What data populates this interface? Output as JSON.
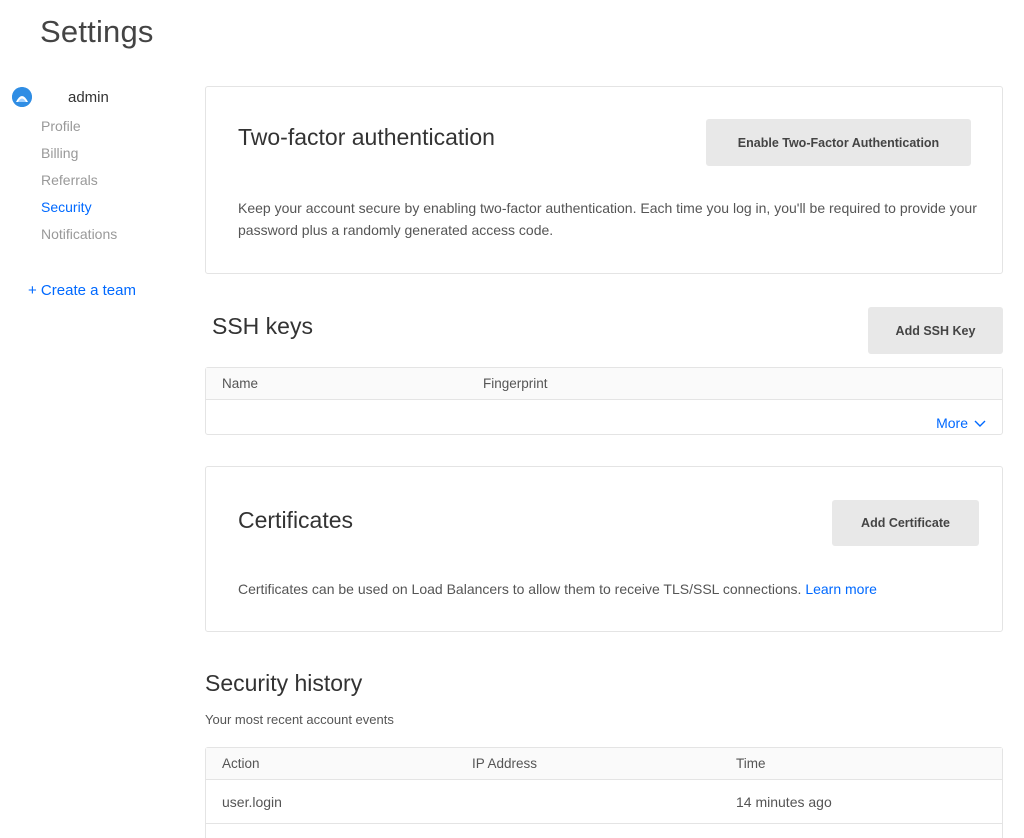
{
  "page": {
    "title": "Settings"
  },
  "sidebar": {
    "account_name": "admin",
    "items": [
      {
        "label": "Profile",
        "active": false
      },
      {
        "label": "Billing",
        "active": false
      },
      {
        "label": "Referrals",
        "active": false
      },
      {
        "label": "Security",
        "active": true
      },
      {
        "label": "Notifications",
        "active": false
      }
    ],
    "create_team_label": "+ Create a team"
  },
  "two_factor": {
    "title": "Two-factor authentication",
    "button_label": "Enable Two-Factor Authentication",
    "description": "Keep your account secure by enabling two-factor authentication. Each time you log in, you'll be required to provide your password plus a randomly generated access code."
  },
  "ssh_keys": {
    "title": "SSH keys",
    "button_label": "Add SSH Key",
    "columns": [
      "Name",
      "Fingerprint"
    ],
    "more_label": "More"
  },
  "certificates": {
    "title": "Certificates",
    "button_label": "Add Certificate",
    "description": "Certificates can be used on Load Balancers to allow them to receive TLS/SSL connections.",
    "learn_more_label": "Learn more"
  },
  "security_history": {
    "title": "Security history",
    "subtitle": "Your most recent account events",
    "columns": [
      "Action",
      "IP Address",
      "Time"
    ],
    "rows": [
      {
        "action": "user.login",
        "ip": "",
        "time": "14 minutes ago"
      }
    ]
  },
  "colors": {
    "accent": "#0069ff",
    "avatar": "#2f8de4",
    "button_bg": "#e8e8e8",
    "border": "#e4e4e4"
  }
}
